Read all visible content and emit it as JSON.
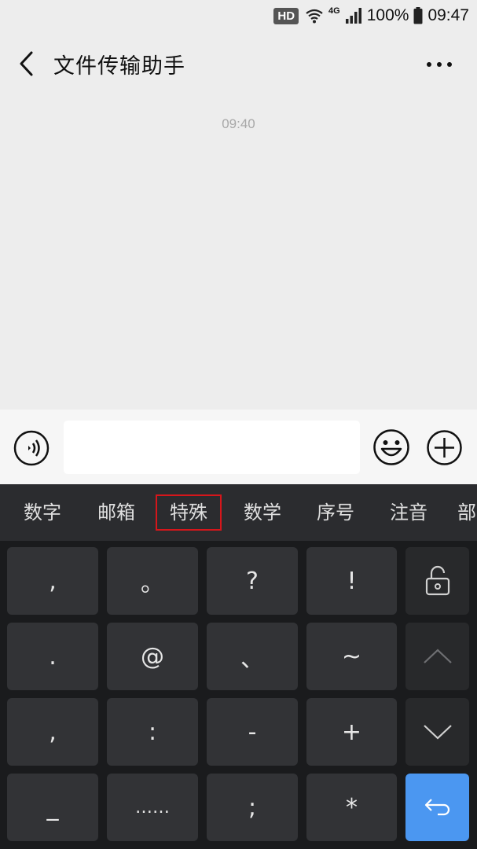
{
  "status_bar": {
    "hd_badge": "HD",
    "network_label": "4G",
    "battery_percent": "100%",
    "time": "09:47"
  },
  "header": {
    "title": "文件传输助手"
  },
  "chat": {
    "timestamp": "09:40"
  },
  "input_bar": {
    "text_value": ""
  },
  "keyboard": {
    "categories": [
      "数字",
      "邮箱",
      "特殊",
      "数学",
      "序号",
      "注音",
      "部"
    ],
    "selected_category": "特殊",
    "keys": [
      [
        ",",
        "。",
        "?",
        "!"
      ],
      [
        ".",
        "@",
        "、",
        "~"
      ],
      [
        ",",
        ":",
        "-",
        "+"
      ],
      [
        "_",
        "……",
        ";",
        "*"
      ]
    ],
    "side_keys": [
      "lock-icon",
      "chevron-up-icon",
      "chevron-down-icon",
      "enter-icon"
    ]
  },
  "colors": {
    "chat_background": "#ededed",
    "keyboard_background": "#1a1b1d",
    "key_background": "#323336",
    "enter_key": "#4b97f1",
    "selected_outline": "#d6161b"
  }
}
